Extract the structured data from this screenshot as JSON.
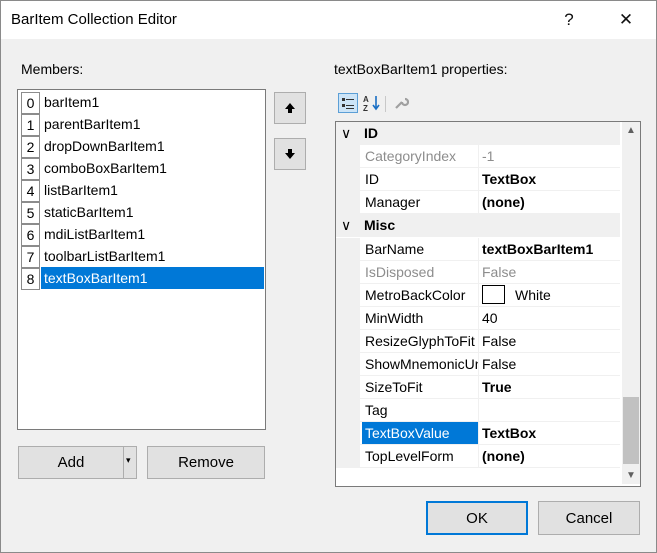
{
  "window": {
    "title": "BarItem Collection Editor",
    "help_glyph": "?",
    "close_glyph": "✕"
  },
  "members": {
    "label": "Members:",
    "items": [
      {
        "index": "0",
        "name": "barItem1"
      },
      {
        "index": "1",
        "name": "parentBarItem1"
      },
      {
        "index": "2",
        "name": "dropDownBarItem1"
      },
      {
        "index": "3",
        "name": "comboBoxBarItem1"
      },
      {
        "index": "4",
        "name": "listBarItem1"
      },
      {
        "index": "5",
        "name": "staticBarItem1"
      },
      {
        "index": "6",
        "name": "mdiListBarItem1"
      },
      {
        "index": "7",
        "name": "toolbarListBarItem1"
      },
      {
        "index": "8",
        "name": "textBoxBarItem1"
      }
    ],
    "selected_index": 8
  },
  "buttons": {
    "add": "Add",
    "remove": "Remove",
    "ok": "OK",
    "cancel": "Cancel"
  },
  "properties": {
    "label": "textBoxBarItem1 properties:",
    "categories": [
      {
        "name": "ID",
        "rows": [
          {
            "name": "CategoryIndex",
            "value": "-1",
            "name_style": "grey",
            "value_style": "grey"
          },
          {
            "name": "ID",
            "value": "TextBox",
            "name_style": "normal",
            "value_style": "bold"
          },
          {
            "name": "Manager",
            "value": "(none)",
            "name_style": "normal",
            "value_style": "bold"
          }
        ]
      },
      {
        "name": "Misc",
        "rows": [
          {
            "name": "BarName",
            "value": "textBoxBarItem1",
            "name_style": "normal",
            "value_style": "bold"
          },
          {
            "name": "IsDisposed",
            "value": "False",
            "name_style": "grey",
            "value_style": "grey"
          },
          {
            "name": "MetroBackColor",
            "value": "White",
            "name_style": "normal",
            "value_style": "normal",
            "swatch": "#ffffff"
          },
          {
            "name": "MinWidth",
            "value": "40",
            "name_style": "normal",
            "value_style": "normal"
          },
          {
            "name": "ResizeGlyphToFit",
            "value": "False",
            "name_style": "normal",
            "value_style": "normal"
          },
          {
            "name": "ShowMnemonicUnderline",
            "value": "False",
            "name_style": "normal",
            "value_style": "normal"
          },
          {
            "name": "SizeToFit",
            "value": "True",
            "name_style": "normal",
            "value_style": "bold"
          },
          {
            "name": "Tag",
            "value": "",
            "name_style": "normal",
            "value_style": "normal"
          },
          {
            "name": "TextBoxValue",
            "value": "TextBox",
            "name_style": "normal",
            "value_style": "bold",
            "selected": true
          },
          {
            "name": "TopLevelForm",
            "value": "(none)",
            "name_style": "normal",
            "value_style": "bold"
          }
        ]
      }
    ]
  },
  "colors": {
    "selection": "#0078d7",
    "dialog_bg": "#f0f0f0"
  }
}
